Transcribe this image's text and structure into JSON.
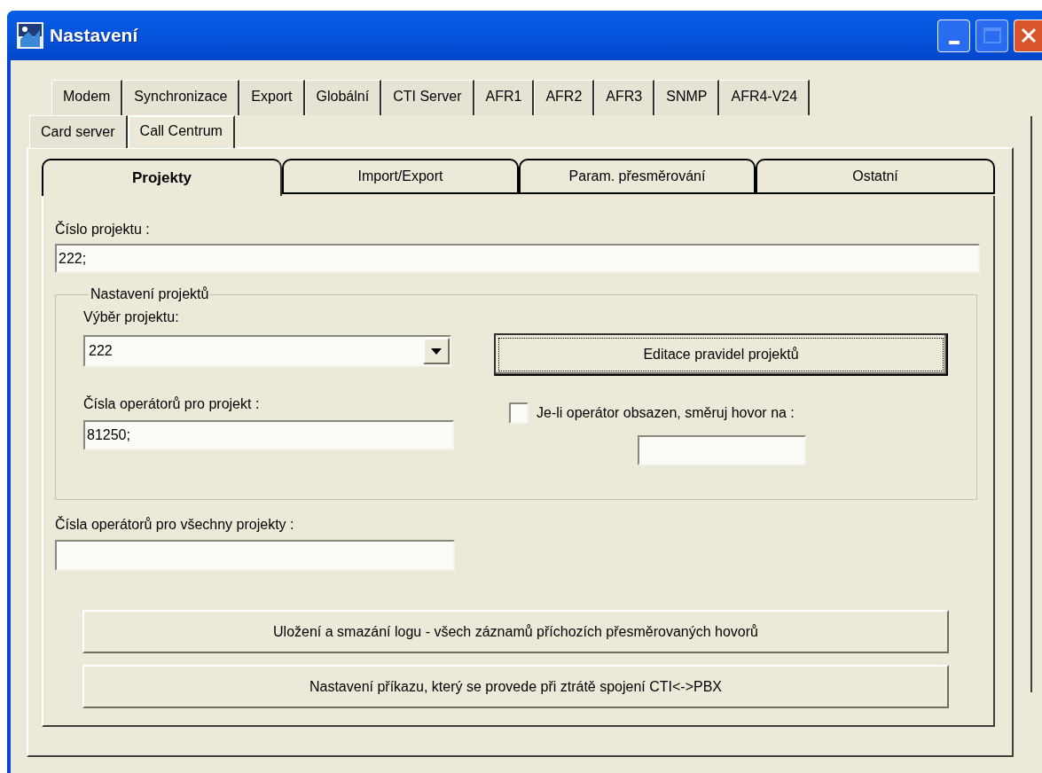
{
  "window": {
    "title": "Nastavení"
  },
  "tabs_row_1": [
    {
      "label": "Modem",
      "selected": false
    },
    {
      "label": "Synchronizace",
      "selected": false
    },
    {
      "label": "Export",
      "selected": false
    },
    {
      "label": "Globální",
      "selected": false
    },
    {
      "label": "CTI Server",
      "selected": false
    },
    {
      "label": "AFR1",
      "selected": false
    },
    {
      "label": "AFR2",
      "selected": false
    },
    {
      "label": "AFR3",
      "selected": false
    },
    {
      "label": "SNMP",
      "selected": false
    },
    {
      "label": "AFR4-V24",
      "selected": false
    }
  ],
  "tabs_row_2": [
    {
      "label": "Card server",
      "selected": false
    },
    {
      "label": "Call Centrum",
      "selected": true
    }
  ],
  "inner_tabs": [
    {
      "label": "Projekty",
      "selected": true
    },
    {
      "label": "Import/Export",
      "selected": false
    },
    {
      "label": "Param. přesměrování",
      "selected": false
    },
    {
      "label": "Ostatní",
      "selected": false
    }
  ],
  "project_number": {
    "label": "Číslo projektu :",
    "value": "222;"
  },
  "project_settings": {
    "title": "Nastavení projektů",
    "project_select": {
      "label": "Výběr projektu:",
      "value": "222"
    },
    "operators": {
      "label": "Čísla operátorů pro projekt :",
      "value": "81250;"
    },
    "edit_rules_button": {
      "label": "Editace pravidel projektů",
      "focused": true
    },
    "busy_redirect": {
      "label": "Je-li operátor obsazen, směruj hovor na :",
      "checked": false
    }
  },
  "all_operators": {
    "label": "Čísla operátorů pro všechny projekty :"
  },
  "buttons": [
    {
      "label": "Uložení a smazání logu - všech záznamů příchozích přesměrovaných hovorů",
      "focused": false
    },
    {
      "label": "Nastavení příkazu, který se provede při ztrátě spojení CTI<->PBX",
      "focused": false
    }
  ]
}
